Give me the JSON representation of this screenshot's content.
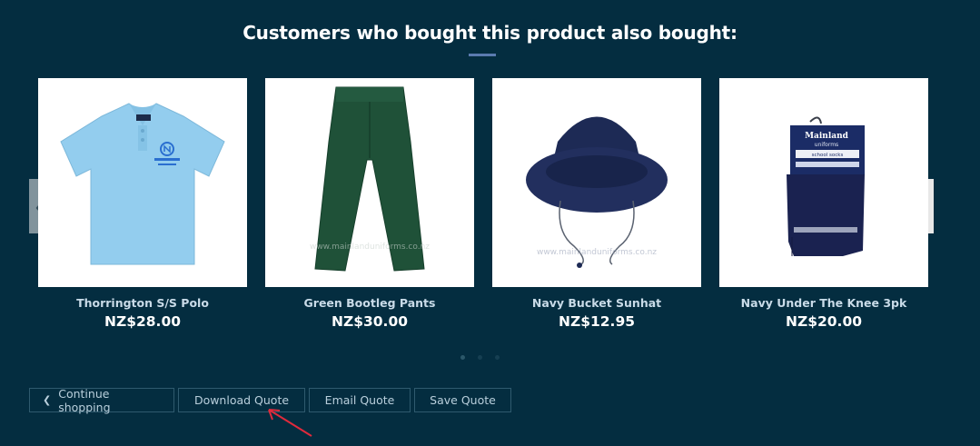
{
  "section": {
    "title": "Customers who bought this product also bought:"
  },
  "products": [
    {
      "name": "Thorrington S/S Polo",
      "price": "NZ$28.00",
      "icon": "polo-shirt-image"
    },
    {
      "name": "Green Bootleg Pants",
      "price": "NZ$30.00",
      "icon": "pants-image"
    },
    {
      "name": "Navy Bucket Sunhat",
      "price": "NZ$12.95",
      "icon": "bucket-hat-image"
    },
    {
      "name": "Navy Under The Knee 3pk",
      "price": "NZ$20.00",
      "icon": "socks-image"
    }
  ],
  "product_image_text": {
    "watermark": "www.mainlanduniforms.co.nz",
    "brand": "Mainland",
    "brand_sub": "uniforms",
    "sock_label": "school socks"
  },
  "carousel": {
    "prev_icon": "chevron-left-icon",
    "next_icon": "chevron-right-icon",
    "page_count": 3,
    "active_page": 1
  },
  "actions": {
    "continue_label": "Continue shopping",
    "download_label": "Download Quote",
    "email_label": "Email Quote",
    "save_label": "Save Quote"
  },
  "colors": {
    "background": "#042d40",
    "accent": "#5a7bb0",
    "annotation": "#e02a3c"
  }
}
